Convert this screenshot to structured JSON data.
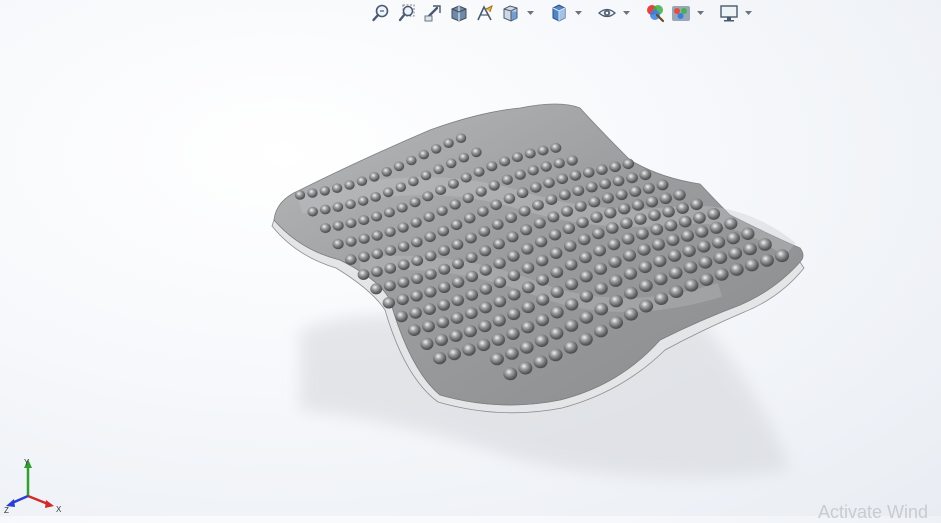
{
  "heads_up_toolbar": {
    "buttons": [
      {
        "icon": "zoom-to-fit-icon"
      },
      {
        "icon": "zoom-to-area-icon"
      },
      {
        "icon": "previous-view-icon"
      },
      {
        "icon": "section-view-icon"
      },
      {
        "icon": "dynamic-annotation-icon"
      },
      {
        "icon": "view-orientation-icon",
        "dropdown": true
      },
      {
        "icon": "display-style-icon",
        "dropdown": true
      },
      {
        "icon": "hide-show-items-icon",
        "dropdown": true
      },
      {
        "icon": "edit-appearance-icon"
      },
      {
        "icon": "apply-scene-icon",
        "dropdown": true
      },
      {
        "icon": "view-settings-icon",
        "dropdown": true
      }
    ]
  },
  "model": {
    "description_icon": "textured-surface-part",
    "surface_color": "#9a9b9d",
    "bump_rows": 14,
    "bump_cols": 22
  },
  "triad": {
    "x_label": "X",
    "y_label": "Y",
    "z_label": "Z",
    "x_color": "#d22a2a",
    "y_color": "#2fa02f",
    "z_color": "#2a3fd2"
  },
  "watermark": {
    "text": "Activate Wind"
  }
}
